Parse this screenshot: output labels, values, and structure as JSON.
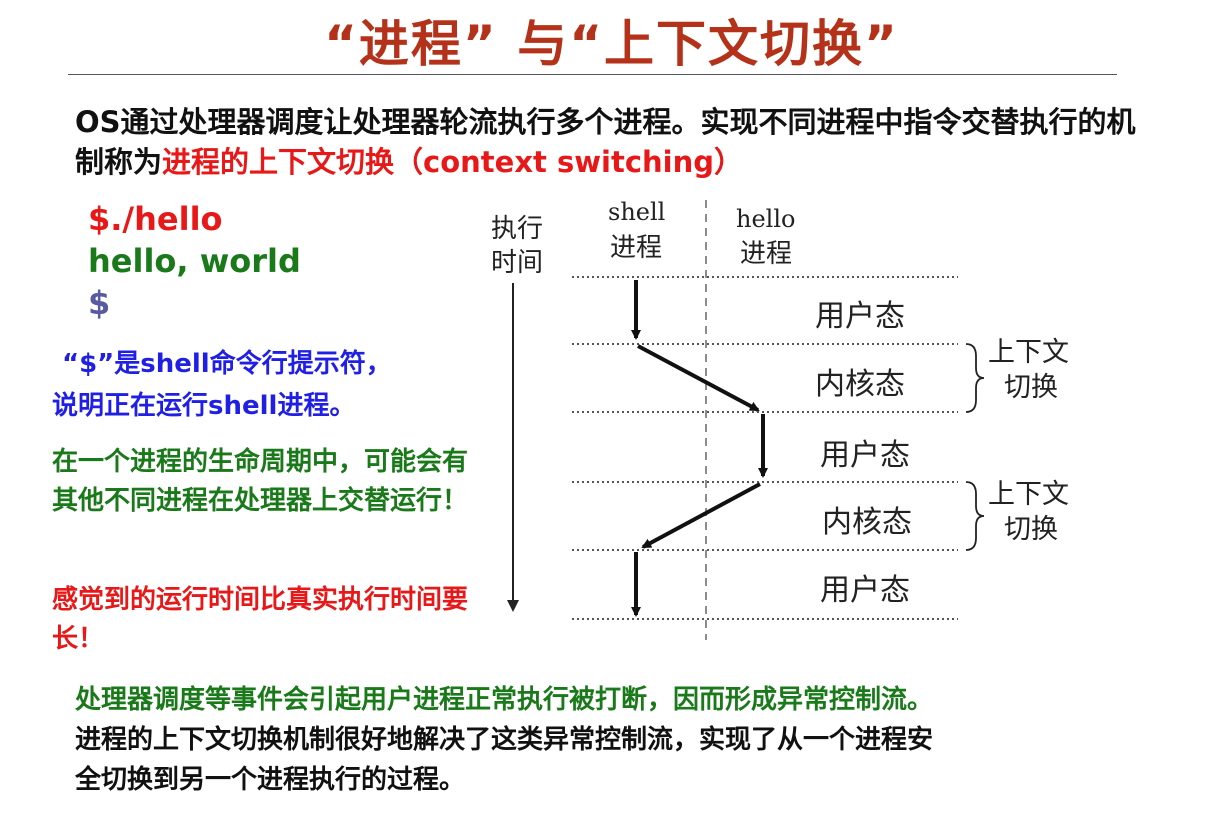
{
  "title": "“进程”  与“上下文切换”",
  "intro": {
    "text1": "OS通过处理器调度让处理器轮流执行多个进程。实现不同进程中指令交替执行的机制称为",
    "highlight": "进程的上下文切换",
    "text2": "（context switching）"
  },
  "terminal": {
    "line1": "$./hello",
    "line2": "hello, world",
    "line3": "$"
  },
  "notes": {
    "prompt_line1": "“$”是shell命令行提示符，",
    "prompt_line2": "说明正在运行shell进程。",
    "lifecycle": "在一个进程的生命周期中，可能会有其他不同进程在处理器上交替运行！",
    "time": "感觉到的运行时间比真实执行时间要长！"
  },
  "diagram": {
    "time_label_1": "执行",
    "time_label_2": "时间",
    "shell_label_1": "shell",
    "shell_label_2": "进程",
    "hello_label_1": "hello",
    "hello_label_2": "进程",
    "states": [
      "用户态",
      "内核态",
      "用户态",
      "内核态",
      "用户态"
    ],
    "switch_label_1": "上下文",
    "switch_label_2": "切换"
  },
  "bottom": {
    "line1": "处理器调度等事件会引起用户进程正常执行被打断，因而形成异常控制流。",
    "line2": "进程的上下文切换机制很好地解决了这类异常控制流，实现了从一个进程安",
    "line3": "全切换到另一个进程执行的过程。"
  },
  "colors": {
    "title": "#b5321a",
    "red": "#e81818",
    "green": "#1a7a1a",
    "blue": "#1f1fe6",
    "slate": "#5a5aa0"
  }
}
